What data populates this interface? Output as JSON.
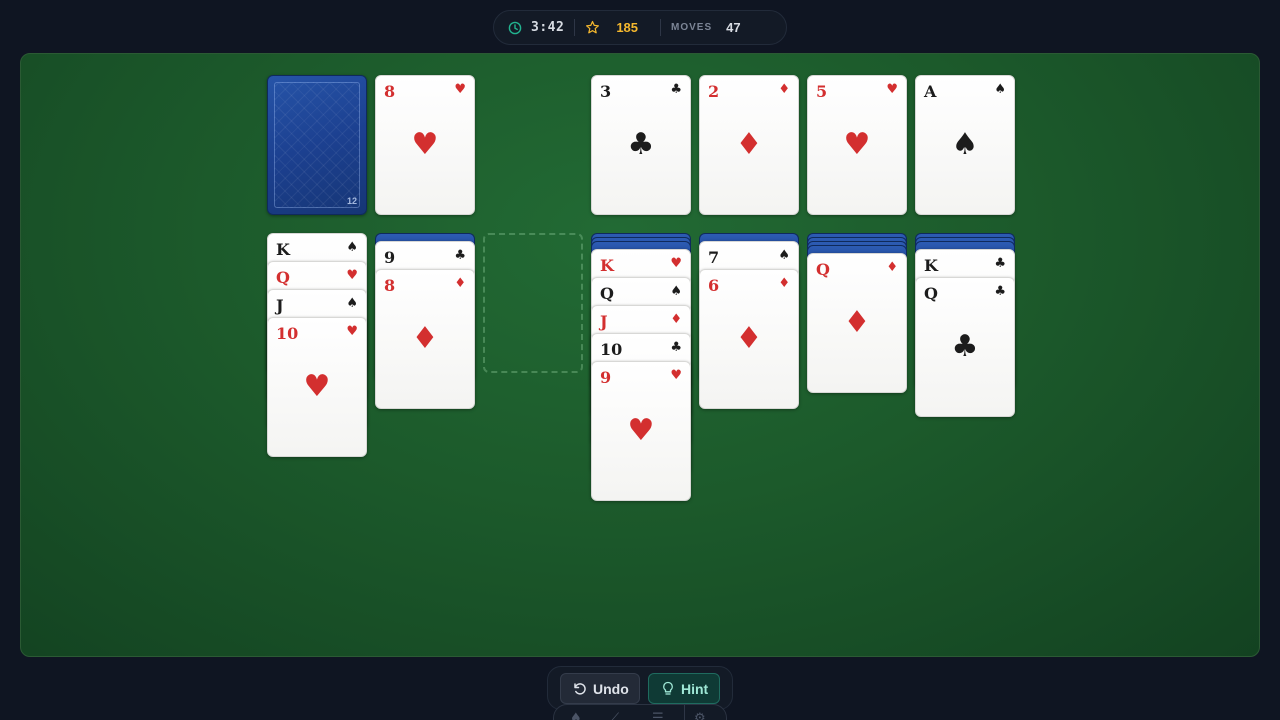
{
  "status": {
    "timer": "3:42",
    "score": "185",
    "moves_label": "MOVES",
    "moves_value": "47",
    "timer_icon": "clock-icon",
    "score_icon": "star-icon"
  },
  "stock": {
    "count": "12"
  },
  "waste": {
    "rank": "8",
    "suit": "♥",
    "color": "red"
  },
  "foundations": [
    {
      "rank": "3",
      "suit": "♣",
      "color": "black"
    },
    {
      "rank": "2",
      "suit": "♦",
      "color": "red"
    },
    {
      "rank": "5",
      "suit": "♥",
      "color": "red"
    },
    {
      "rank": "A",
      "suit": "♠",
      "color": "black"
    }
  ],
  "tableau": [
    {
      "hidden": 0,
      "cards": [
        {
          "rank": "K",
          "suit": "♠",
          "color": "black"
        },
        {
          "rank": "Q",
          "suit": "♥",
          "color": "red"
        },
        {
          "rank": "J",
          "suit": "♠",
          "color": "black"
        },
        {
          "rank": "10",
          "suit": "♥",
          "color": "red"
        }
      ]
    },
    {
      "hidden": 1,
      "cards": [
        {
          "rank": "9",
          "suit": "♣",
          "color": "black"
        },
        {
          "rank": "8",
          "suit": "♦",
          "color": "red"
        }
      ]
    },
    {
      "hidden": 0,
      "cards": []
    },
    {
      "hidden": 3,
      "cards": [
        {
          "rank": "K",
          "suit": "♥",
          "color": "red"
        },
        {
          "rank": "Q",
          "suit": "♠",
          "color": "black"
        },
        {
          "rank": "J",
          "suit": "♦",
          "color": "red"
        },
        {
          "rank": "10",
          "suit": "♣",
          "color": "black"
        },
        {
          "rank": "9",
          "suit": "♥",
          "color": "red"
        }
      ]
    },
    {
      "hidden": 1,
      "cards": [
        {
          "rank": "7",
          "suit": "♠",
          "color": "black"
        },
        {
          "rank": "6",
          "suit": "♦",
          "color": "red"
        }
      ]
    },
    {
      "hidden": 4,
      "cards": [
        {
          "rank": "Q",
          "suit": "♦",
          "color": "red"
        }
      ]
    },
    {
      "hidden": 3,
      "cards": [
        {
          "rank": "K",
          "suit": "♣",
          "color": "black"
        },
        {
          "rank": "Q",
          "suit": "♣",
          "color": "black"
        }
      ]
    }
  ],
  "controls": {
    "undo_label": "Undo",
    "hint_label": "Hint",
    "undo_icon": "undo-icon",
    "hint_icon": "lightbulb-icon"
  },
  "dock": {
    "items": [
      "spade-icon",
      "broom-icon",
      "menu-icon",
      "settings-icon"
    ]
  },
  "colors": {
    "felt": "#1c5a2b",
    "card_back": "#1c4090",
    "red_suit": "#d32f2f",
    "black_suit": "#1c1c1c",
    "score": "#f5b82e",
    "hint_accent": "#9fe8d6"
  }
}
